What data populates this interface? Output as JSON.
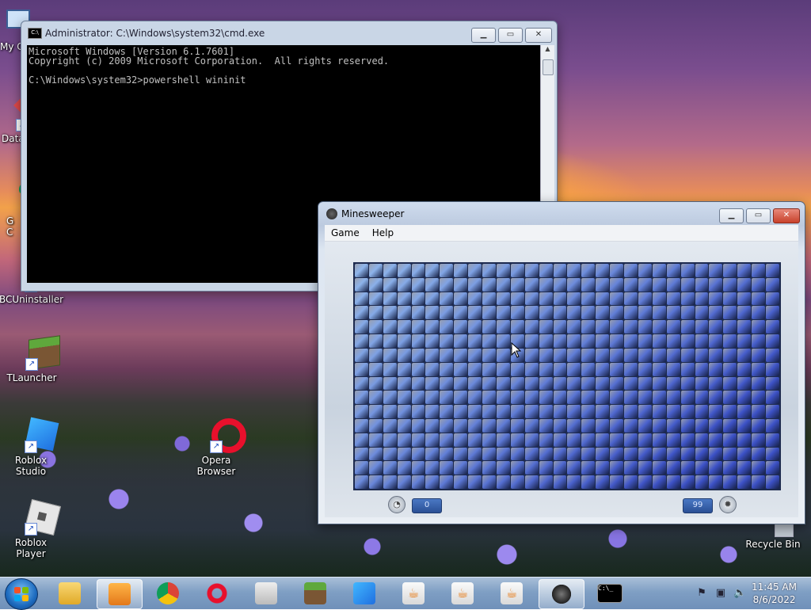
{
  "desktop": {
    "icons": [
      {
        "label": "My C",
        "icon": "computer-icon"
      },
      {
        "label": "Data",
        "icon": "shortcut-icon"
      },
      {
        "label": "G C",
        "icon": "chrome-shortcut-icon"
      },
      {
        "label": "BCUninstaller",
        "icon": "uninstaller-icon"
      },
      {
        "label": "TLauncher",
        "icon": "minecraft-block-icon"
      },
      {
        "label": "Roblox Studio",
        "icon": "roblox-studio-icon"
      },
      {
        "label": "Opera Browser",
        "icon": "opera-icon"
      },
      {
        "label": "Roblox Player",
        "icon": "roblox-player-icon"
      },
      {
        "label": "Recycle Bin",
        "icon": "recycle-bin-icon"
      }
    ]
  },
  "cmd": {
    "title": "Administrator: C:\\Windows\\system32\\cmd.exe",
    "lines": [
      "Microsoft Windows [Version 6.1.7601]",
      "Copyright (c) 2009 Microsoft Corporation.  All rights reserved.",
      "",
      "C:\\Windows\\system32>powershell wininit"
    ]
  },
  "minesweeper": {
    "title": "Minesweeper",
    "menu": [
      "Game",
      "Help"
    ],
    "columns": 30,
    "rows": 16,
    "time_counter": "0",
    "mines_counter": "99",
    "colors": {
      "tile_light": "#8fb6ec",
      "tile_dark": "#3d52c7",
      "board_border": "#1d2a4f"
    }
  },
  "taskbar": {
    "items": [
      "windows-explorer-icon",
      "media-player-icon",
      "chrome-icon",
      "opera-icon",
      "roblox-player-icon",
      "minecraft-icon",
      "roblox-studio-icon",
      "java-icon",
      "java-icon",
      "java-icon",
      "minesweeper-icon",
      "cmd-icon"
    ],
    "time": "11:45 AM",
    "date": "8/6/2022"
  }
}
